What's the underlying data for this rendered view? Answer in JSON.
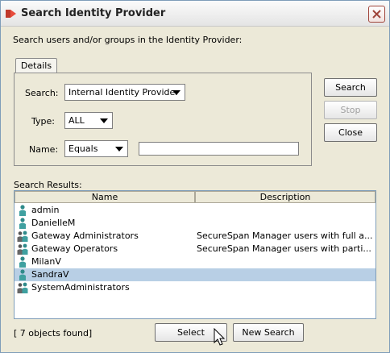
{
  "window": {
    "title": "Search Identity Provider"
  },
  "intro_text": "Search users and/or groups in the Identity Provider:",
  "details_tab": "Details",
  "fields": {
    "search_label": "Search:",
    "search_value": "Internal Identity Provider",
    "type_label": "Type:",
    "type_value": "ALL",
    "name_label": "Name:",
    "name_mode": "Equals",
    "name_value": ""
  },
  "side_buttons": {
    "search": "Search",
    "stop": "Stop",
    "close": "Close"
  },
  "results": {
    "label": "Search Results:",
    "columns": [
      "Name",
      "Description"
    ],
    "rows": [
      {
        "name": "admin",
        "description": "",
        "kind": "user",
        "selected": false
      },
      {
        "name": "DanielleM",
        "description": "",
        "kind": "user",
        "selected": false
      },
      {
        "name": "Gateway Administrators",
        "description": "SecureSpan Manager users with full a...",
        "kind": "group",
        "selected": false
      },
      {
        "name": "Gateway Operators",
        "description": "SecureSpan Manager users with parti...",
        "kind": "group",
        "selected": false
      },
      {
        "name": "MilanV",
        "description": "",
        "kind": "user",
        "selected": false
      },
      {
        "name": "SandraV",
        "description": "",
        "kind": "user",
        "selected": true
      },
      {
        "name": "SystemAdministrators",
        "description": "",
        "kind": "group",
        "selected": false
      }
    ]
  },
  "status_text": "[ 7 objects found]",
  "bottom_buttons": {
    "select": "Select",
    "new_search": "New Search"
  },
  "icons": {
    "user": "user-icon",
    "group": "group-icon",
    "app": "app-logo-icon",
    "close": "close-icon"
  }
}
